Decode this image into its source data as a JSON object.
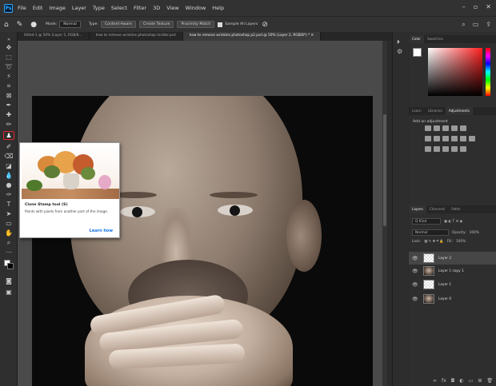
{
  "app": {
    "logo": "Ps"
  },
  "menu": [
    "File",
    "Edit",
    "Image",
    "Layer",
    "Type",
    "Select",
    "Filter",
    "3D",
    "View",
    "Window",
    "Help"
  ],
  "window_controls": [
    "–",
    "▫",
    "✕"
  ],
  "options_bar": {
    "mode_label": "Mode:",
    "mode_value": "Normal",
    "type_label": "Type:",
    "buttons": [
      "Content-Aware",
      "Create Texture",
      "Proximity Match"
    ],
    "sample_label": "Sample All Layers"
  },
  "tabs": [
    "ititled-1 @ 50% (Layer 1, RGB/8...",
    "how to remove wrinkles photoshop Insider.psd",
    "how to remove wrinkles photoshop p2.psd @ 50% (Layer 2, RGB/8*) *  ✕"
  ],
  "tooltip": {
    "title": "Clone Stamp tool (S)",
    "description": "Paints with pixels from another part of the image.",
    "link": "Learn how"
  },
  "color_panel": {
    "tabs": [
      "Color",
      "Swatches"
    ]
  },
  "adjust_panel": {
    "tabs": [
      "Learn",
      "Libraries",
      "Adjustments"
    ],
    "add_label": "Add an adjustment"
  },
  "layers_panel": {
    "tabs": [
      "Layers",
      "Channels",
      "Paths"
    ],
    "filter_value": "Q Kind",
    "blend_mode": "Normal",
    "opacity_label": "Opacity:",
    "opacity_value": "100%",
    "lock_label": "Lock:",
    "fill_label": "Fill:",
    "fill_value": "100%",
    "layers": [
      {
        "name": "Layer 2",
        "thumb": "checker",
        "selected": true
      },
      {
        "name": "Layer 1 copy 1",
        "thumb": "face",
        "selected": false
      },
      {
        "name": "Layer 1",
        "thumb": "checker",
        "selected": false
      },
      {
        "name": "Layer 0",
        "thumb": "face",
        "selected": false
      }
    ]
  }
}
